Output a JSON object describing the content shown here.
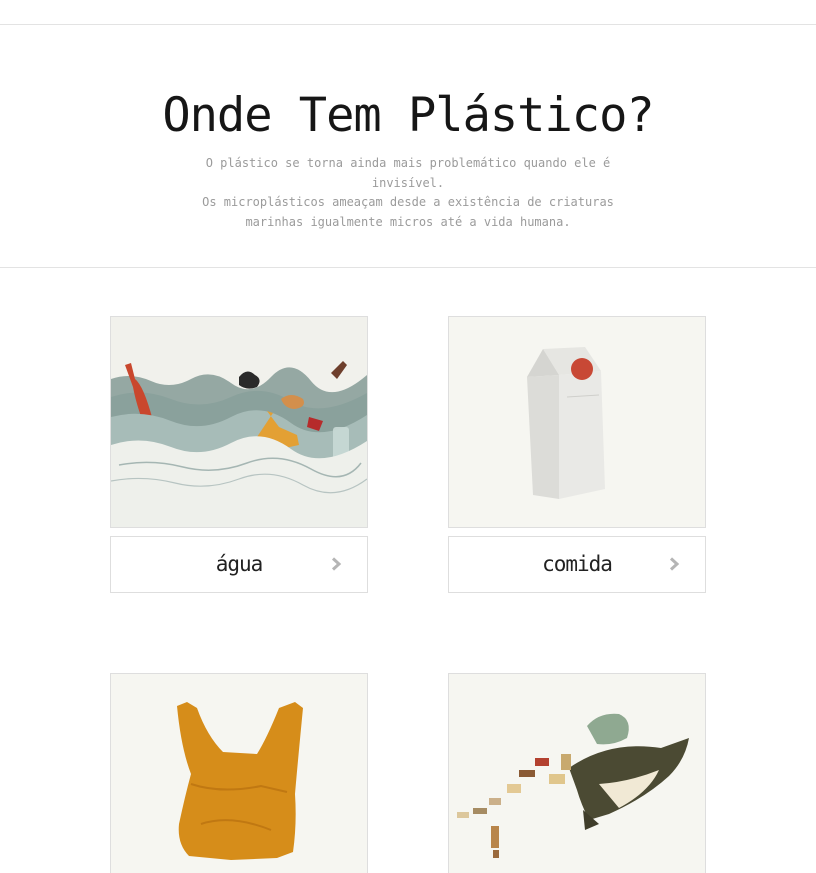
{
  "hero": {
    "title": "Onde Tem Plástico?",
    "subtitle_lines": [
      "O plástico se torna ainda mais problemático quando ele é invisível.",
      "Os microplásticos ameaçam desde a existência de criaturas",
      "marinhas igualmente micros até a vida humana."
    ]
  },
  "cards": [
    {
      "label": "água",
      "icon": "chevron-right-icon",
      "illustration": "ocean-trash-illustration"
    },
    {
      "label": "comida",
      "icon": "chevron-right-icon",
      "illustration": "milk-carton-illustration"
    },
    {
      "label": "",
      "icon": "chevron-right-icon",
      "illustration": "plastic-bag-illustration"
    },
    {
      "label": "",
      "icon": "chevron-right-icon",
      "illustration": "whale-trash-illustration"
    }
  ],
  "colors": {
    "border": "#dedede",
    "image_bg": "#f4f4ef",
    "title": "#161616",
    "subtitle": "#9b9b9b",
    "chevron": "#b5b5b5"
  }
}
